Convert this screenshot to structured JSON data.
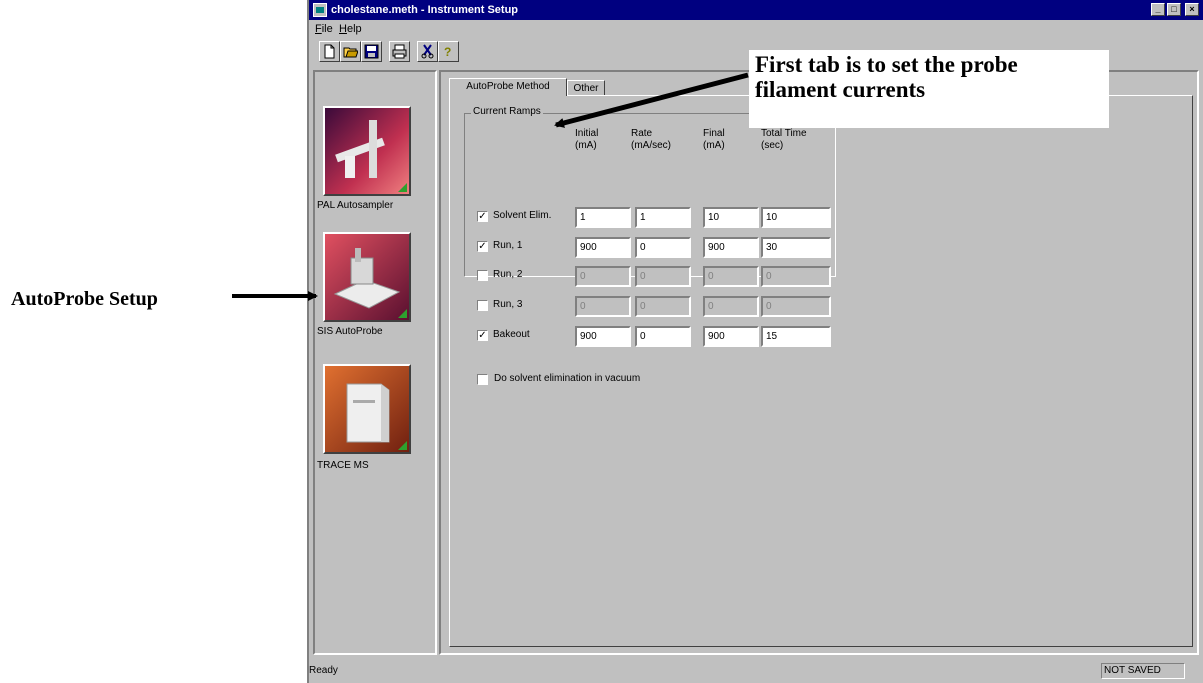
{
  "window": {
    "title": "cholestane.meth - Instrument Setup",
    "min_glyph": "_",
    "max_glyph": "□",
    "close_glyph": "×"
  },
  "menu": {
    "file": "File",
    "help": "Help"
  },
  "toolbar": {
    "icons": [
      "new-document-icon",
      "open-folder-icon",
      "save-disk-icon",
      "print-icon",
      "cut-icon",
      "help-icon"
    ]
  },
  "instruments": [
    {
      "label": "PAL Autosampler",
      "icon": "autosampler-icon"
    },
    {
      "label": "SIS AutoProbe",
      "icon": "autoprobe-icon"
    },
    {
      "label": "TRACE MS",
      "icon": "mass-spectrometer-icon"
    }
  ],
  "tabs": [
    {
      "label": "AutoProbe Method",
      "active": true
    },
    {
      "label": "Other",
      "active": false
    }
  ],
  "group_title": "Current Ramps",
  "columns": [
    {
      "line1": "Initial",
      "line2": "(mA)"
    },
    {
      "line1": "Rate",
      "line2": "(mA/sec)"
    },
    {
      "line1": "Final",
      "line2": "(mA)"
    },
    {
      "line1": "Total Time",
      "line2": "(sec)"
    }
  ],
  "rows": [
    {
      "label": "Solvent Elim.",
      "checked": true,
      "values": [
        "1",
        "1",
        "10",
        "10"
      ],
      "enabled": true
    },
    {
      "label": "Run, 1",
      "checked": true,
      "values": [
        "900",
        "0",
        "900",
        "30"
      ],
      "enabled": true
    },
    {
      "label": "Run, 2",
      "checked": false,
      "values": [
        "0",
        "0",
        "0",
        "0"
      ],
      "enabled": false
    },
    {
      "label": "Run, 3",
      "checked": false,
      "values": [
        "0",
        "0",
        "0",
        "0"
      ],
      "enabled": false
    },
    {
      "label": "Bakeout",
      "checked": true,
      "values": [
        "900",
        "0",
        "900",
        "15"
      ],
      "enabled": true
    }
  ],
  "vacuum_option": {
    "label": "Do solvent elimination in vacuum",
    "checked": false
  },
  "status": {
    "left": "Ready",
    "right": "NOT SAVED"
  },
  "check_glyph": "✓",
  "annotations": {
    "tab_note": "First tab is to set the probe filament currents",
    "autoprobe_note": "AutoProbe Setup"
  },
  "colors": {
    "titlebar": "#000080",
    "face": "#c0c0c0",
    "indicator": "#2ea02e"
  }
}
